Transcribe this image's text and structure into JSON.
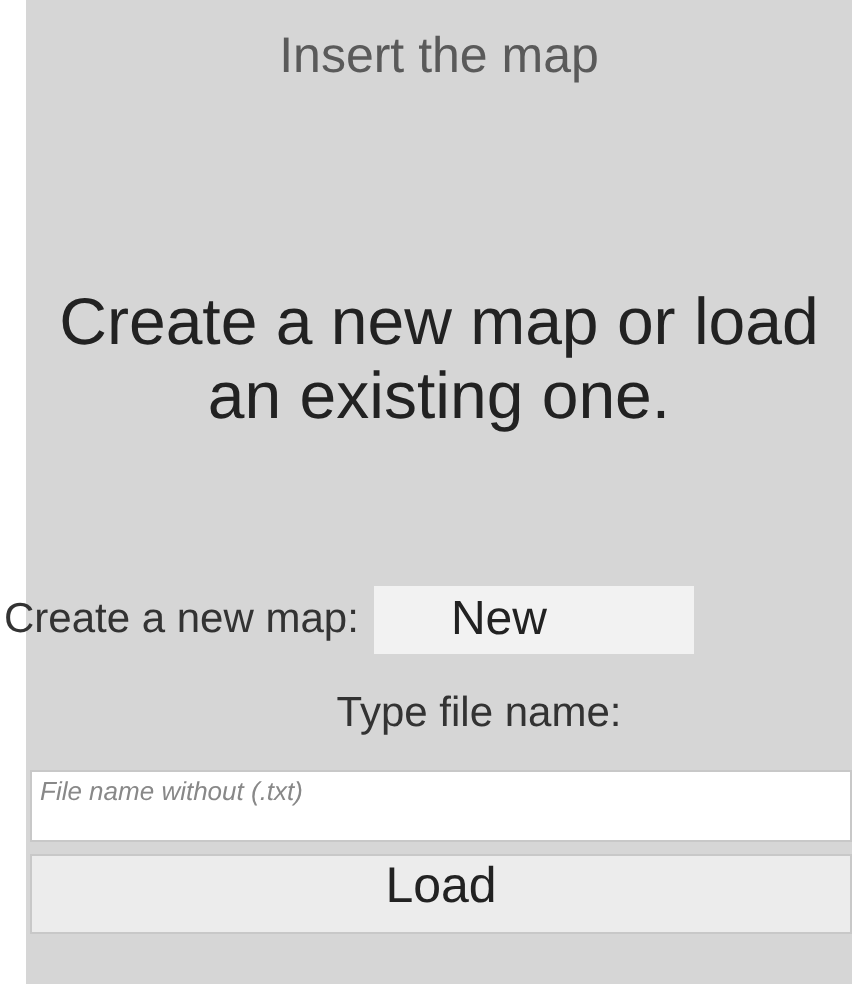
{
  "title": "Insert the map",
  "message": "Create a new map or load an existing one.",
  "new_map": {
    "label": "Create a new map:",
    "button": "New"
  },
  "file": {
    "label": "Type file name:",
    "placeholder": "File name without (.txt)"
  },
  "load_button": "Load"
}
